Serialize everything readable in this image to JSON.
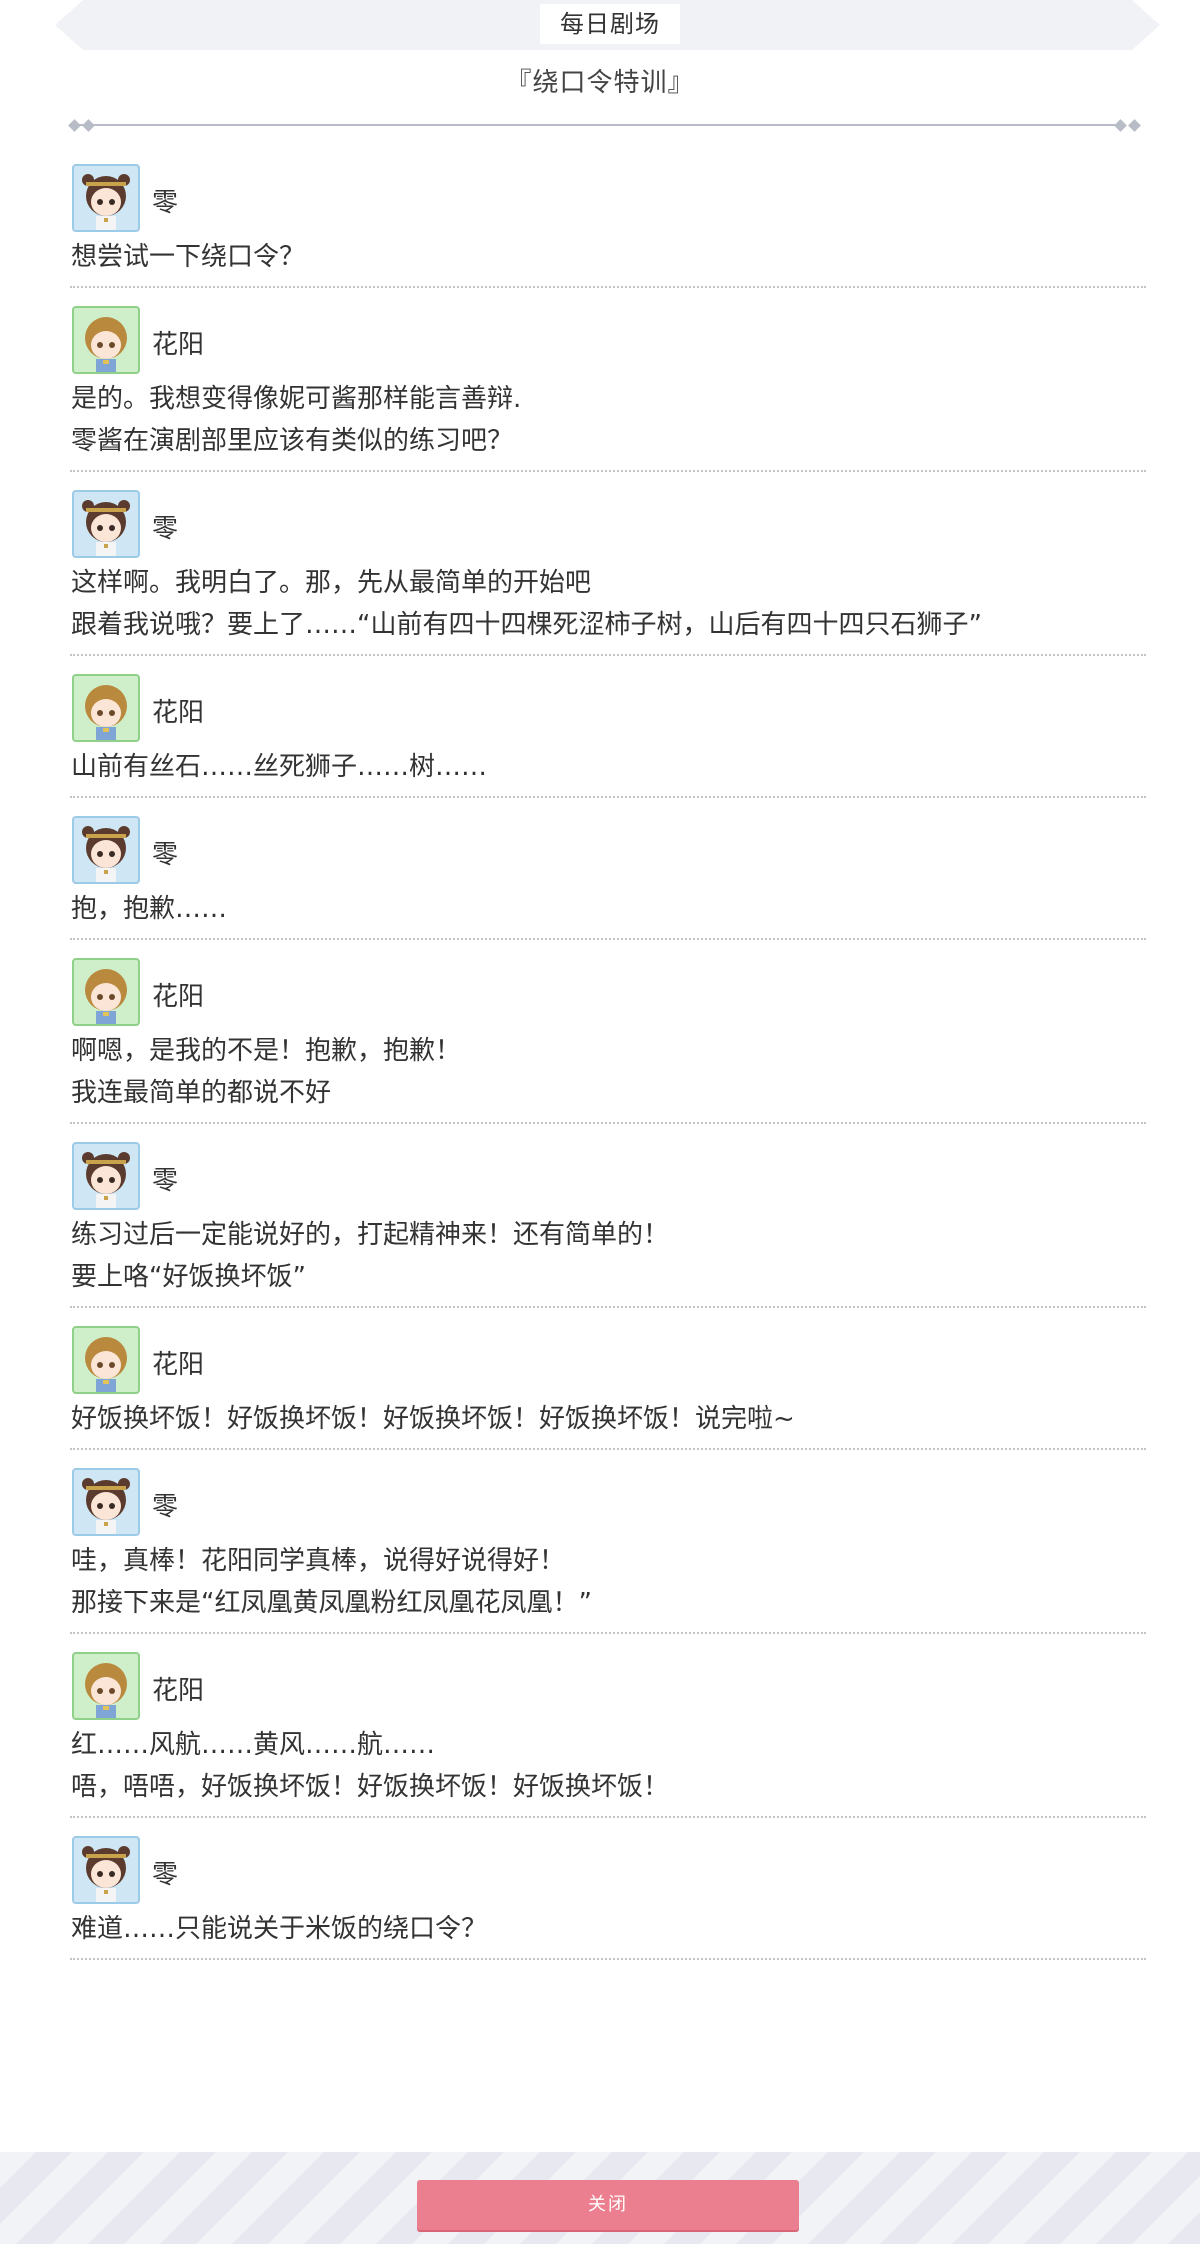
{
  "header": {
    "title": "每日剧场",
    "subtitle": "『绕口令特训』"
  },
  "dialog": [
    {
      "speaker": "零",
      "avatar": "rei",
      "lines": [
        "想尝试一下绕口令？"
      ]
    },
    {
      "speaker": "花阳",
      "avatar": "hanayo",
      "lines": [
        "是的。我想变得像妮可酱那样能言善辩.",
        "零酱在演剧部里应该有类似的练习吧？"
      ]
    },
    {
      "speaker": "零",
      "avatar": "rei",
      "lines": [
        "这样啊。我明白了。那，先从最简单的开始吧",
        "跟着我说哦？要上了……“山前有四十四棵死涩柿子树，山后有四十四只石狮子”"
      ]
    },
    {
      "speaker": "花阳",
      "avatar": "hanayo",
      "lines": [
        "山前有丝石……丝死狮子……树……"
      ]
    },
    {
      "speaker": "零",
      "avatar": "rei",
      "lines": [
        "抱，抱歉……"
      ]
    },
    {
      "speaker": "花阳",
      "avatar": "hanayo",
      "lines": [
        "啊嗯，是我的不是！抱歉，抱歉！",
        "我连最简单的都说不好"
      ]
    },
    {
      "speaker": "零",
      "avatar": "rei",
      "lines": [
        "练习过后一定能说好的，打起精神来！还有简单的！",
        "要上咯“好饭换坏饭”"
      ]
    },
    {
      "speaker": "花阳",
      "avatar": "hanayo",
      "lines": [
        "好饭换坏饭！好饭换坏饭！好饭换坏饭！好饭换坏饭！说完啦~"
      ]
    },
    {
      "speaker": "零",
      "avatar": "rei",
      "lines": [
        "哇，真棒！花阳同学真棒，说得好说得好！",
        "那接下来是“红凤凰黄凤凰粉红凤凰花凤凰！”"
      ]
    },
    {
      "speaker": "花阳",
      "avatar": "hanayo",
      "lines": [
        "红……风航……黄风……航……",
        "唔，唔唔，好饭换坏饭！好饭换坏饭！好饭换坏饭！"
      ]
    },
    {
      "speaker": "零",
      "avatar": "rei",
      "lines": [
        "难道……只能说关于米饭的绕口令？"
      ]
    }
  ],
  "footer": {
    "close_label": "关闭"
  },
  "colors": {
    "close_button": "#ec7f8f",
    "rei_avatar_bg": "#cfe6f5",
    "hanayo_avatar_bg": "#cfeeca"
  }
}
